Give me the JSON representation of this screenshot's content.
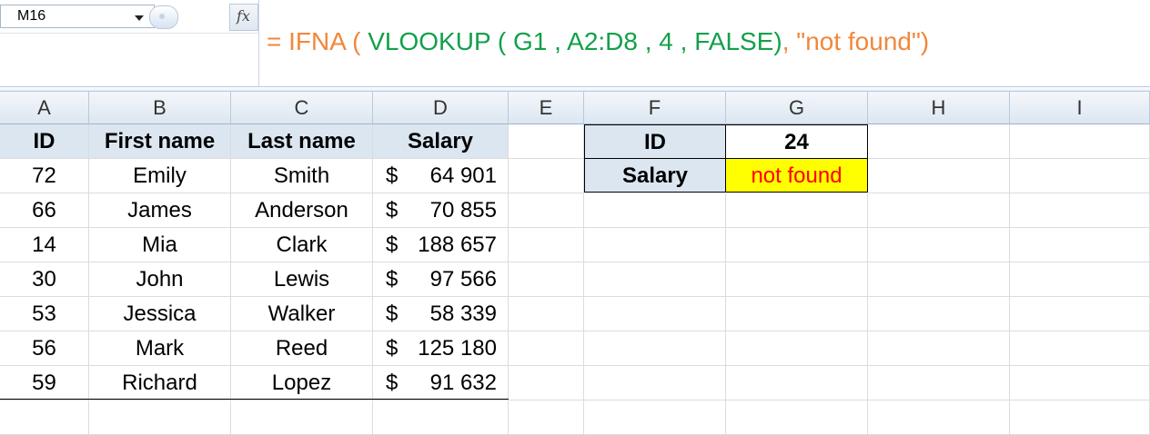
{
  "name_box": {
    "value": "M16"
  },
  "formula_bar": {
    "fx_label": "fx",
    "parts": [
      {
        "text": "= IFNA ( ",
        "color": "orange"
      },
      {
        "text": "VLOOKUP ( G1 , A2:D8 , 4 , FALSE)",
        "color": "green"
      },
      {
        "text": ", \"not found\")",
        "color": "orange"
      }
    ]
  },
  "columns": [
    "A",
    "B",
    "C",
    "D",
    "E",
    "F",
    "G",
    "H",
    "I"
  ],
  "table": {
    "headers": [
      "ID",
      "First name",
      "Last name",
      "Salary"
    ],
    "rows": [
      [
        "72",
        "Emily",
        "Smith",
        "64 901"
      ],
      [
        "66",
        "James",
        "Anderson",
        "70 855"
      ],
      [
        "14",
        "Mia",
        "Clark",
        "188 657"
      ],
      [
        "30",
        "John",
        "Lewis",
        "97 566"
      ],
      [
        "53",
        "Jessica",
        "Walker",
        "58 339"
      ],
      [
        "56",
        "Mark",
        "Reed",
        "125 180"
      ],
      [
        "59",
        "Richard",
        "Lopez",
        "91 632"
      ]
    ],
    "currency": "$"
  },
  "lookup": {
    "id_label": "ID",
    "id_value": "24",
    "salary_label": "Salary",
    "salary_value": "not found"
  },
  "colors": {
    "header_fill": "#dce6f1",
    "highlight": "#ffff00",
    "error_text": "#ff0000",
    "formula_orange": "#f2873a",
    "formula_green": "#12a04a"
  }
}
